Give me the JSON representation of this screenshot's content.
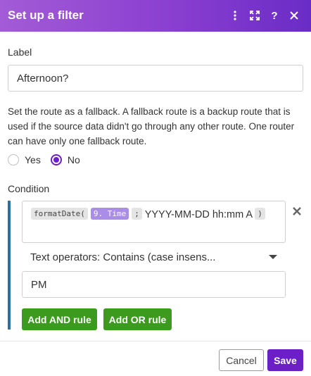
{
  "header": {
    "title": "Set up a filter",
    "icons": [
      "kebab-menu-icon",
      "expand-icon",
      "help-icon",
      "close-icon"
    ],
    "help_glyph": "?"
  },
  "label_field": {
    "label": "Label",
    "value": "Afternoon?"
  },
  "fallback": {
    "description": "Set the route as a fallback. A fallback route is a backup route that is used if the source data didn't go through any other route. One router can have only one fallback route.",
    "options": [
      {
        "label": "Yes",
        "checked": false
      },
      {
        "label": "No",
        "checked": true
      }
    ]
  },
  "condition": {
    "label": "Condition",
    "expression": {
      "function_token": "formatDate(",
      "variable_token": "9. Time",
      "separator_token": ";",
      "format_text": "YYYY-MM-DD hh:mm A",
      "close_token": ")"
    },
    "operator": "Text operators: Contains (case insens...",
    "value": "PM",
    "add_and_label": "Add AND rule",
    "add_or_label": "Add OR rule"
  },
  "footer": {
    "cancel_label": "Cancel",
    "save_label": "Save"
  },
  "colors": {
    "header_gradient_start": "#a35bd6",
    "header_gradient_end": "#6a2cc6",
    "accent_purple": "#6c1fc9",
    "variable_token": "#a98de6",
    "green_button": "#3c9a1f",
    "condition_bar": "#2e6f9e"
  }
}
